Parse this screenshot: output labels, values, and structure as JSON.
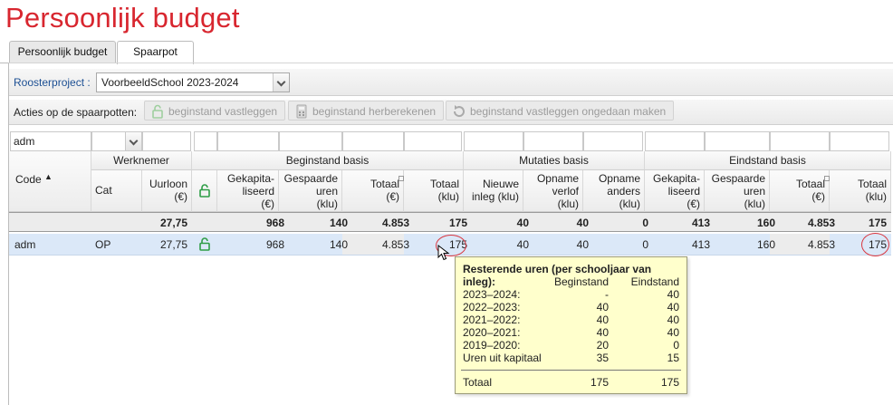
{
  "page": {
    "title": "Persoonlijk budget"
  },
  "tabs": [
    {
      "label": "Persoonlijk budget",
      "active": false
    },
    {
      "label": "Spaarpot",
      "active": true
    }
  ],
  "toolbar": {
    "project_label": "Roosterproject :",
    "project_value": "VoorbeeldSchool 2023-2024",
    "actions_label": "Acties op de spaarpotten:",
    "actions": [
      {
        "label": "beginstand vastleggen",
        "icon": "lock-open-icon",
        "enabled": false
      },
      {
        "label": "beginstand herberekenen",
        "icon": "calculator-icon",
        "enabled": false
      },
      {
        "label": "beginstand vastleggen ongedaan maken",
        "icon": "undo-icon",
        "enabled": false
      }
    ]
  },
  "filters": {
    "code": "adm",
    "cat": ""
  },
  "headers": {
    "code": "Code",
    "groups": {
      "werknemer": "Werknemer",
      "beginstand": "Beginstand basis",
      "mutaties": "Mutaties basis",
      "eindstand": "Eindstand basis"
    },
    "columns": {
      "cat": "Cat",
      "uurloon": [
        "Uurloon",
        "(€)"
      ],
      "b_gekap": [
        "Gekapita-",
        "liseerd",
        "(€)"
      ],
      "b_gesp": [
        "Gespaarde",
        "uren",
        "(klu)"
      ],
      "b_tot_eur": [
        "Totaal",
        "(€)"
      ],
      "b_tot_klu": [
        "Totaal",
        "(klu)"
      ],
      "m_nieuwe": [
        "Nieuwe",
        "inleg (klu)"
      ],
      "m_verlof": [
        "Opname",
        "verlof",
        "(klu)"
      ],
      "m_anders": [
        "Opname",
        "anders",
        "(klu)"
      ],
      "e_gekap": [
        "Gekapita-",
        "liseerd",
        "(€)"
      ],
      "e_gesp": [
        "Gespaarde",
        "uren",
        "(klu)"
      ],
      "e_tot_eur": [
        "Totaal",
        "(€)"
      ],
      "e_tot_klu": [
        "Totaal",
        "(klu)"
      ]
    }
  },
  "totals": {
    "uurloon": "27,75",
    "b_gekap": "968",
    "b_gesp": "140",
    "b_tot_eur": "4.853",
    "b_tot_klu": "175",
    "m_nieuwe": "40",
    "m_verlof": "40",
    "m_anders": "0",
    "e_gekap": "413",
    "e_gesp": "160",
    "e_tot_eur": "4.853",
    "e_tot_klu": "175"
  },
  "row": {
    "code": "adm",
    "cat": "OP",
    "uurloon": "27,75",
    "b_gekap": "968",
    "b_gesp": "140",
    "b_tot_eur": "4.853",
    "b_tot_klu": "175",
    "m_nieuwe": "40",
    "m_verlof": "40",
    "m_anders": "0",
    "e_gekap": "413",
    "e_gesp": "160",
    "e_tot_eur": "4.853",
    "e_tot_klu": "175"
  },
  "tooltip": {
    "title": "Resterende uren (per schooljaar van inleg):",
    "col_begin": "Beginstand",
    "col_end": "Eindstand",
    "rows": [
      {
        "label": "2023–2024:",
        "begin": "-",
        "end": "40"
      },
      {
        "label": "2022–2023:",
        "begin": "40",
        "end": "40"
      },
      {
        "label": "2021–2022:",
        "begin": "40",
        "end": "40"
      },
      {
        "label": "2020–2021:",
        "begin": "40",
        "end": "40"
      },
      {
        "label": "2019–2020:",
        "begin": "20",
        "end": "0"
      },
      {
        "label": "Uren uit kapitaal",
        "begin": "35",
        "end": "15"
      }
    ],
    "total": {
      "label": "Totaal",
      "begin": "175",
      "end": "175"
    }
  },
  "colors": {
    "title_red": "#d8262f",
    "label_blue": "#1c4f93",
    "selected_row": "#dbe8f8",
    "tooltip_bg": "#ffffcc",
    "circle_red": "#d9363e",
    "lock_green": "#2e9d46"
  }
}
